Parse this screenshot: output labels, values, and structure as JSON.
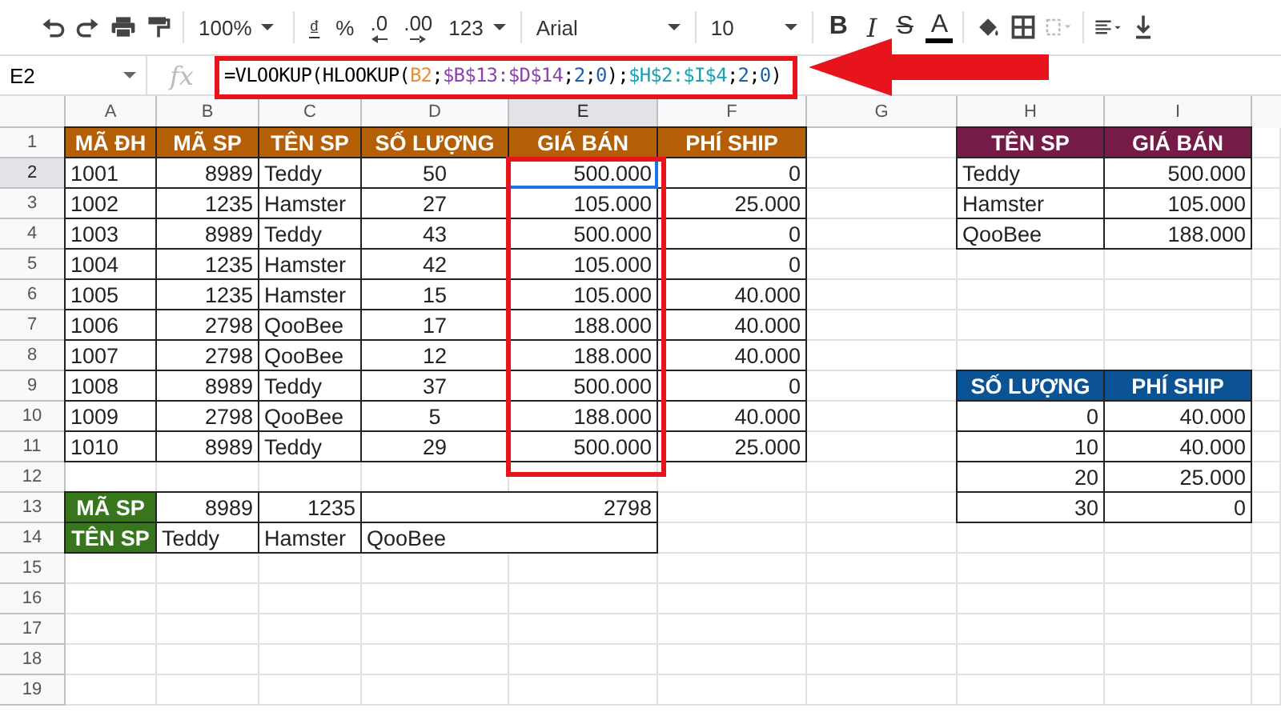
{
  "toolbar": {
    "zoom": "100%",
    "currency": "₫",
    "percent": "%",
    "decrease_decimal": ".0",
    "increase_decimal": ".00",
    "number_format": "123",
    "font": "Arial",
    "font_size": "10",
    "bold": "B",
    "italic": "I",
    "strikethrough": "S",
    "text_color": "A"
  },
  "formula_bar": {
    "name_box": "E2",
    "fx": "fx",
    "formula_parts": [
      {
        "text": "=VLOOKUP(HLOOKUP(",
        "color": "#000000"
      },
      {
        "text": "B2",
        "color": "#e69138"
      },
      {
        "text": ";",
        "color": "#000000"
      },
      {
        "text": "$B$13:$D$14",
        "color": "#8e44ad"
      },
      {
        "text": ";",
        "color": "#000000"
      },
      {
        "text": "2",
        "color": "#1a5fb4"
      },
      {
        "text": ";",
        "color": "#000000"
      },
      {
        "text": "0",
        "color": "#1a5fb4"
      },
      {
        "text": ");",
        "color": "#000000"
      },
      {
        "text": "$H$2:$I$4",
        "color": "#17a2b8"
      },
      {
        "text": ";",
        "color": "#000000"
      },
      {
        "text": "2",
        "color": "#1a5fb4"
      },
      {
        "text": ";",
        "color": "#000000"
      },
      {
        "text": "0",
        "color": "#1a5fb4"
      },
      {
        "text": ")",
        "color": "#000000"
      }
    ]
  },
  "column_headers": [
    {
      "label": "A",
      "selected": false
    },
    {
      "label": "B",
      "selected": false
    },
    {
      "label": "C",
      "selected": false
    },
    {
      "label": "D",
      "selected": false
    },
    {
      "label": "E",
      "selected": true
    },
    {
      "label": "F",
      "selected": false
    },
    {
      "label": "G",
      "selected": false
    },
    {
      "label": "H",
      "selected": false
    },
    {
      "label": "I",
      "selected": false
    }
  ],
  "row_headers": [
    {
      "label": "1",
      "selected": false
    },
    {
      "label": "2",
      "selected": true
    },
    {
      "label": "3",
      "selected": false
    },
    {
      "label": "4",
      "selected": false
    },
    {
      "label": "5",
      "selected": false
    },
    {
      "label": "6",
      "selected": false
    },
    {
      "label": "7",
      "selected": false
    },
    {
      "label": "8",
      "selected": false
    },
    {
      "label": "9",
      "selected": false
    },
    {
      "label": "10",
      "selected": false
    },
    {
      "label": "11",
      "selected": false
    },
    {
      "label": "12",
      "selected": false
    },
    {
      "label": "13",
      "selected": false
    },
    {
      "label": "14",
      "selected": false
    },
    {
      "label": "15",
      "selected": false
    },
    {
      "label": "16",
      "selected": false
    },
    {
      "label": "17",
      "selected": false
    },
    {
      "label": "18",
      "selected": false
    },
    {
      "label": "19",
      "selected": false
    }
  ],
  "orders_table": {
    "columns": [
      "MÃ ĐH",
      "MÃ SP",
      "TÊN SP",
      "SỐ LƯỢNG",
      "GIÁ BÁN",
      "PHÍ SHIP"
    ],
    "rows": [
      [
        "1001",
        "8989",
        "Teddy",
        "50",
        "500.000",
        "0"
      ],
      [
        "1002",
        "1235",
        "Hamster",
        "27",
        "105.000",
        "25.000"
      ],
      [
        "1003",
        "8989",
        "Teddy",
        "43",
        "500.000",
        "0"
      ],
      [
        "1004",
        "1235",
        "Hamster",
        "42",
        "105.000",
        "0"
      ],
      [
        "1005",
        "1235",
        "Hamster",
        "15",
        "105.000",
        "40.000"
      ],
      [
        "1006",
        "2798",
        "QooBee",
        "17",
        "188.000",
        "40.000"
      ],
      [
        "1007",
        "2798",
        "QooBee",
        "12",
        "188.000",
        "40.000"
      ],
      [
        "1008",
        "8989",
        "Teddy",
        "37",
        "500.000",
        "0"
      ],
      [
        "1009",
        "2798",
        "QooBee",
        "5",
        "188.000",
        "40.000"
      ],
      [
        "1010",
        "8989",
        "Teddy",
        "29",
        "500.000",
        "25.000"
      ]
    ]
  },
  "price_table": {
    "columns": [
      "TÊN SP",
      "GIÁ BÁN"
    ],
    "rows": [
      [
        "Teddy",
        "500.000"
      ],
      [
        "Hamster",
        "105.000"
      ],
      [
        "QooBee",
        "188.000"
      ]
    ]
  },
  "shipping_table": {
    "columns": [
      "SỐ LƯỢNG",
      "PHÍ SHIP"
    ],
    "rows": [
      [
        "0",
        "40.000"
      ],
      [
        "10",
        "40.000"
      ],
      [
        "20",
        "25.000"
      ],
      [
        "30",
        "0"
      ]
    ]
  },
  "product_lookup": {
    "rows": [
      {
        "label": "MÃ SP",
        "values": [
          "8989",
          "1235",
          "2798"
        ]
      },
      {
        "label": "TÊN SP",
        "values": [
          "Teddy",
          "Hamster",
          "QooBee"
        ]
      }
    ]
  }
}
